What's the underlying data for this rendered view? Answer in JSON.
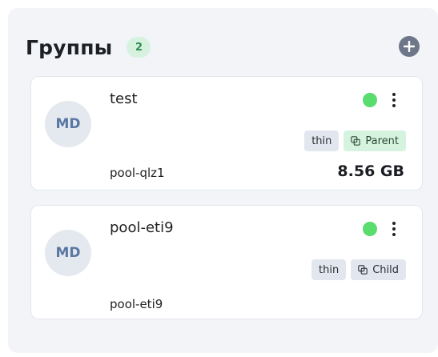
{
  "header": {
    "title": "Группы",
    "count": "2"
  },
  "icons": {
    "add": "plus-circle-icon",
    "menu": "more-vertical-icon",
    "relation": "overlap-squares-icon"
  },
  "colors": {
    "status_online": "#5bdc6f",
    "count_badge_bg": "#d6f2df",
    "parent_tag_bg": "#d6f3df",
    "tag_gray_bg": "#e2e7ef",
    "avatar_bg": "#e4e9f0",
    "avatar_text": "#5a77a2"
  },
  "groups": [
    {
      "avatar": "MD",
      "name": "test",
      "status": "online",
      "tags": {
        "type": "thin",
        "role": "Parent"
      },
      "pool": "pool-qlz1",
      "size": "8.56 GB"
    },
    {
      "avatar": "MD",
      "name": "pool-eti9",
      "status": "online",
      "tags": {
        "type": "thin",
        "role": "Child"
      },
      "pool": "pool-eti9"
    }
  ]
}
